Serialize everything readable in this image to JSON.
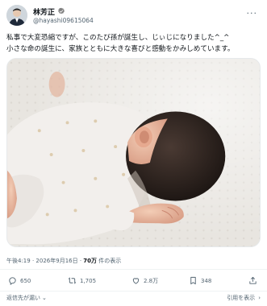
{
  "tweet": {
    "author_name": "林芳正",
    "handle": "@hayashi09615064",
    "body": [
      "私事で大変恐縮ですが、このたび孫が誕生し、じぃじになりました^_^",
      "小さな命の誕生に、家族とともに大きな喜びと感動をかみしめています。"
    ],
    "time": "午後4:19",
    "date": "2026年9月16日",
    "views_count": "70万",
    "views_label": "件の表示"
  },
  "actions": {
    "replies": "650",
    "retweets": "1,705",
    "likes": "2.8万",
    "bookmarks": "348"
  },
  "footer": {
    "reply_setting": "返信先が漏い",
    "replies_link": "引用を表示"
  },
  "colors": {
    "verified": "#808080",
    "text": "#0f1419",
    "secondary": "#536471"
  }
}
